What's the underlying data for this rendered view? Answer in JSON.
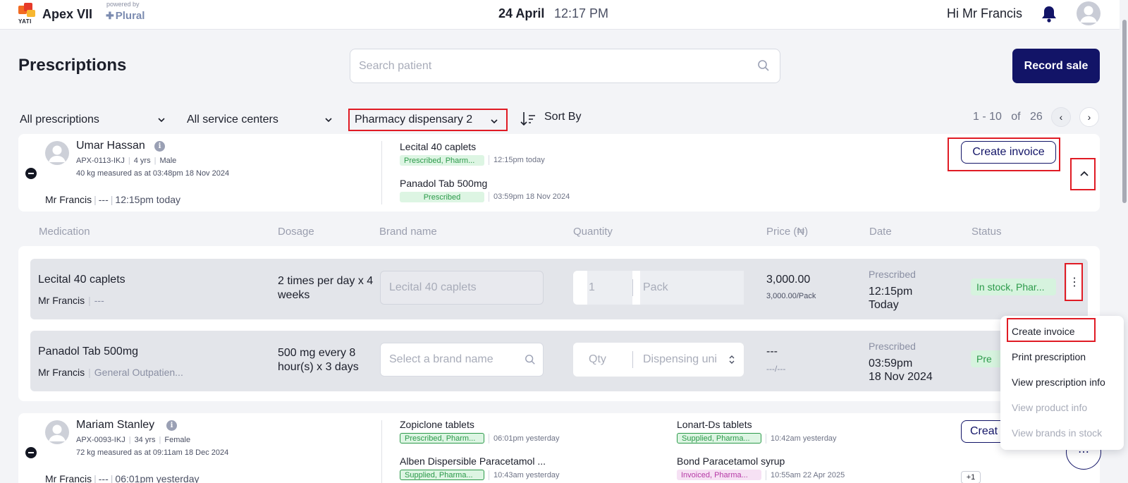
{
  "app": {
    "name": "Apex VII",
    "logo_text": "YATI",
    "powered_by": "powered by",
    "partner": "Plural",
    "date": "24 April",
    "time": "12:17 PM",
    "greeting": "Hi Mr Francis"
  },
  "page": {
    "title": "Prescriptions",
    "search_placeholder": "Search patient",
    "record_sale_label": "Record sale"
  },
  "filters": {
    "prescriptions": "All prescriptions",
    "service_centers": "All service centers",
    "dispensary": "Pharmacy dispensary 2",
    "sort_label": "Sort By",
    "pagination": {
      "range": "1 - 10",
      "of": "of",
      "total": "26"
    }
  },
  "patients": [
    {
      "name": "Umar Hassan",
      "id": "APX-0113-IKJ",
      "age": "4 yrs",
      "sex": "Male",
      "weight": "40 kg measured as at 03:48pm 18 Nov 2024",
      "doctor": "Mr Francis",
      "dept": "---",
      "time": "12:15pm today",
      "prescriptions": [
        {
          "name": "Lecital 40 caplets",
          "badge": "Prescribed, Pharm...",
          "time": "12:15pm today"
        },
        {
          "name": "Panadol Tab 500mg",
          "badge": "Prescribed",
          "time": "03:59pm 18 Nov 2024"
        }
      ],
      "create_invoice": "Create invoice"
    },
    {
      "name": "Mariam Stanley",
      "id": "APX-0093-IKJ",
      "age": "34 yrs",
      "sex": "Female",
      "weight": "72 kg measured as at 09:11am 18 Dec 2024",
      "doctor": "Mr Francis",
      "dept": "---",
      "time": "06:01pm yesterday",
      "prescriptions": [
        {
          "name": "Zopiclone tablets",
          "badge": "Prescribed, Pharm...",
          "time": "06:01pm yesterday"
        },
        {
          "name": "Alben Dispersible Paracetamol ...",
          "badge": "Supplied, Pharma...",
          "time": "10:43am yesterday"
        },
        {
          "name": "Lonart-Ds tablets",
          "badge": "Supplied, Pharma...",
          "time": "10:42am yesterday"
        },
        {
          "name": "Bond Paracetamol syrup",
          "badge": "Invoiced, Pharma...",
          "time": "10:55am 22 Apr 2025"
        }
      ],
      "create_invoice": "Creat",
      "more_count": "+1"
    }
  ],
  "table": {
    "headers": {
      "medication": "Medication",
      "dosage": "Dosage",
      "brand": "Brand name",
      "quantity": "Quantity",
      "price": "Price (₦)",
      "date": "Date",
      "status": "Status"
    },
    "rows": [
      {
        "medication": "Lecital 40 caplets",
        "doctor": "Mr Francis",
        "dept": "---",
        "dosage": "2 times per day x 4 weeks",
        "brand_value": "Lecital 40 caplets",
        "qty_value": "1",
        "unit_value": "Pack",
        "price": "3,000.00",
        "price_sub": "3,000.00/Pack",
        "date_label": "Prescribed",
        "date_line1": "12:15pm",
        "date_line2": "Today",
        "status": "In stock, Phar..."
      },
      {
        "medication": "Panadol Tab 500mg",
        "doctor": "Mr Francis",
        "dept": "General Outpatien...",
        "dosage": "500 mg every 8 hour(s) x 3 days",
        "brand_placeholder": "Select a brand name",
        "qty_placeholder": "Qty",
        "unit_placeholder": "Dispensing uni",
        "price": "---",
        "price_sub": "---/---",
        "date_label": "Prescribed",
        "date_line1": "03:59pm",
        "date_line2": "18 Nov 2024",
        "status": "Pre"
      }
    ]
  },
  "menu": {
    "items": [
      {
        "label": "Create invoice",
        "enabled": true
      },
      {
        "label": "Print prescription",
        "enabled": true
      },
      {
        "label": "View prescription info",
        "enabled": true
      },
      {
        "label": "View product info",
        "enabled": false
      },
      {
        "label": "View brands in stock",
        "enabled": false
      }
    ]
  },
  "colors": {
    "primary": "#121467",
    "highlight": "#e01b24",
    "success": "#2c9a4a",
    "invoiced": "#b63aa6"
  }
}
